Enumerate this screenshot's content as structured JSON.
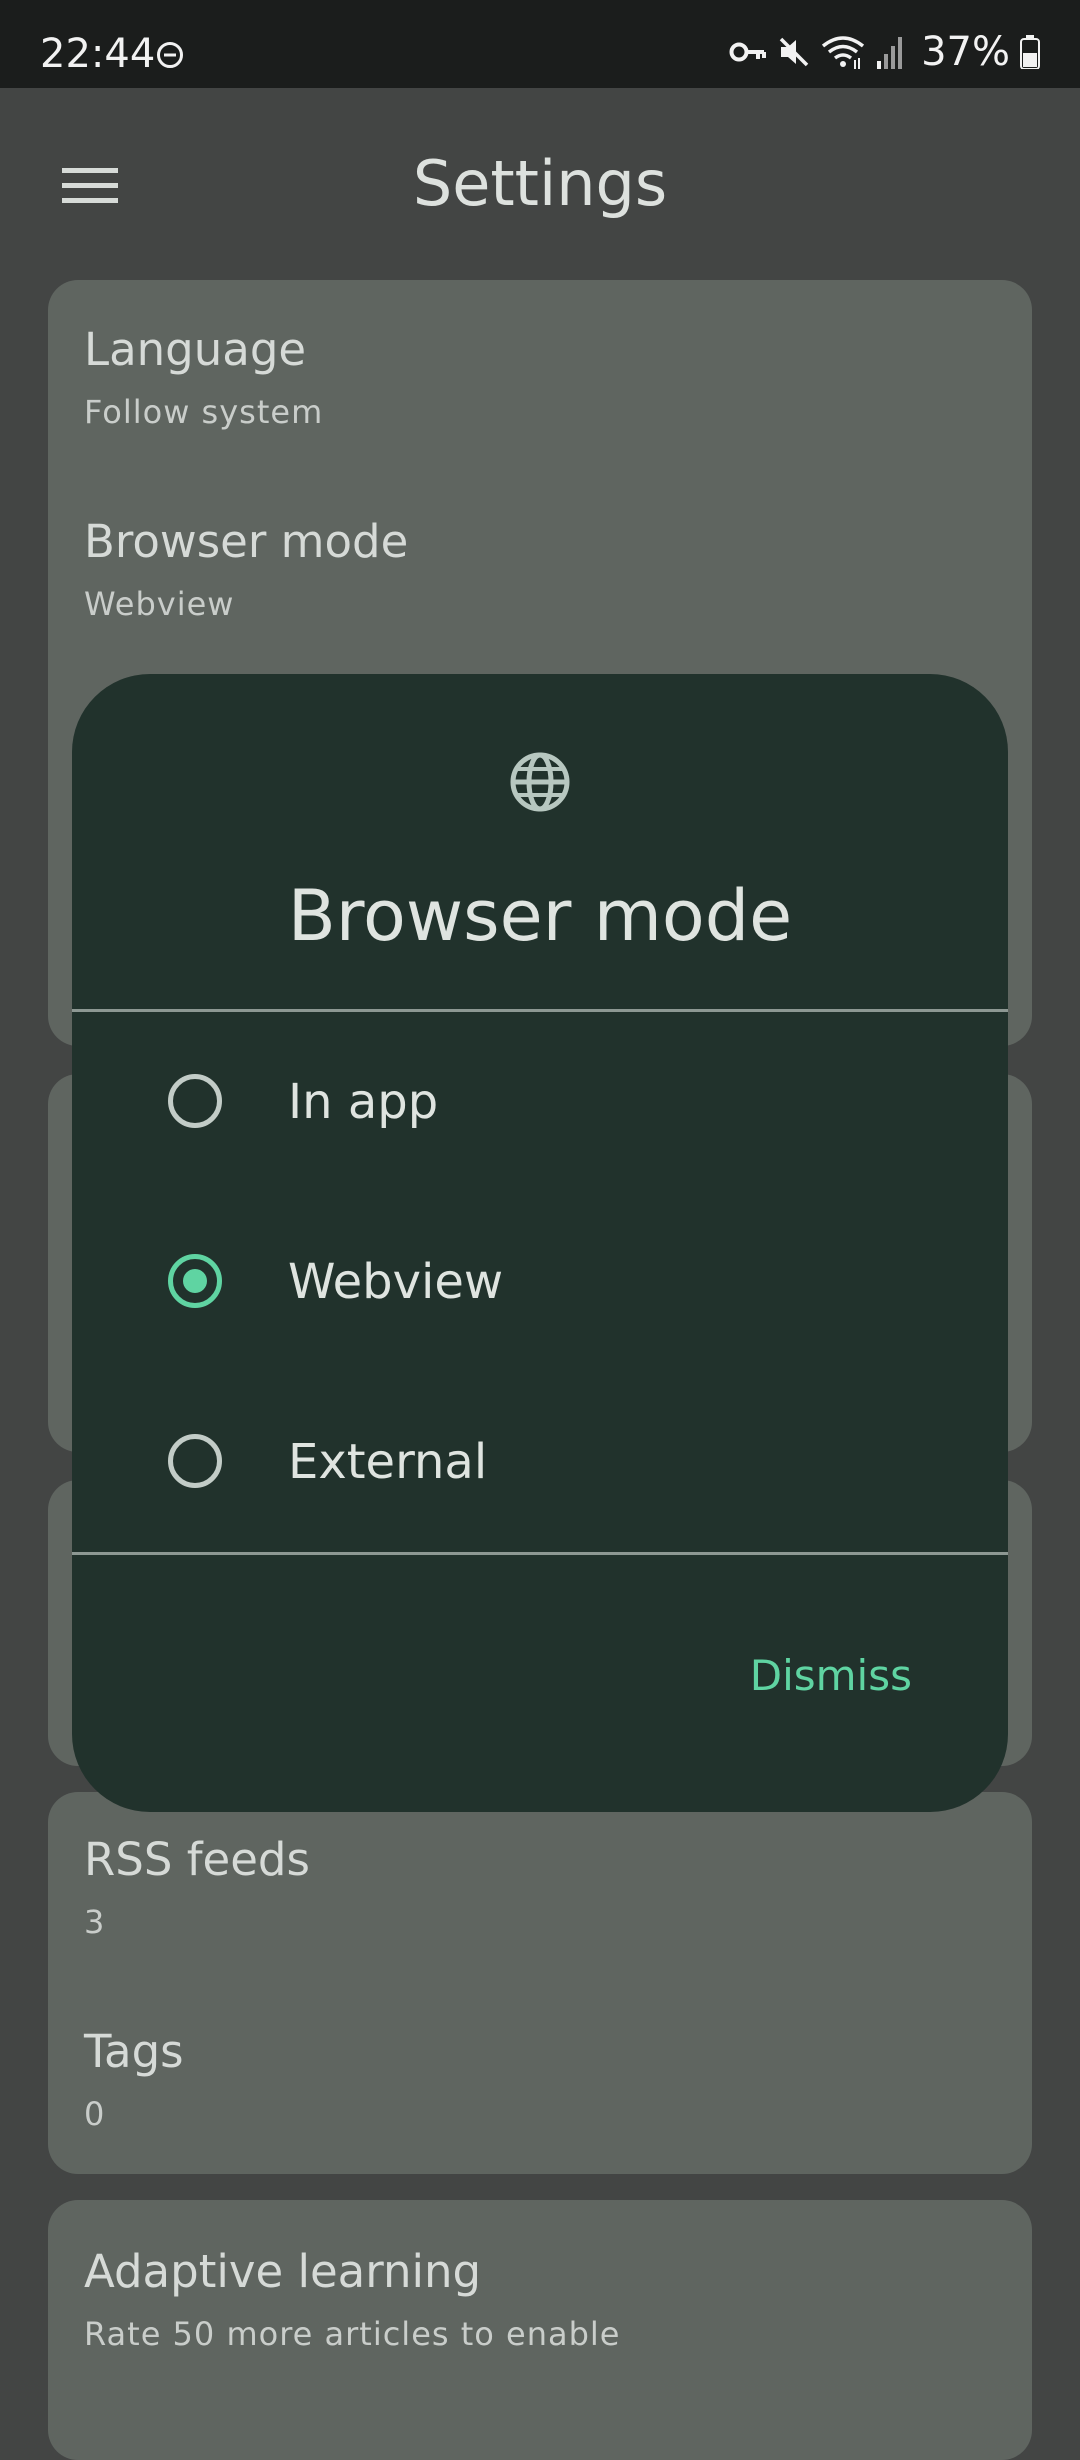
{
  "status_bar": {
    "time": "22:44",
    "battery": "37%",
    "icons": [
      "do-not-disturb-icon",
      "vpn-key-icon",
      "mute-icon",
      "wifi-icon",
      "signal-icon",
      "battery-icon"
    ]
  },
  "header": {
    "title": "Settings",
    "menu_icon": "hamburger-menu-icon"
  },
  "settings": {
    "card1": [
      {
        "title": "Language",
        "subtitle": "Follow system"
      },
      {
        "title": "Browser mode",
        "subtitle": "Webview"
      }
    ],
    "card4": [
      {
        "title": "RSS feeds",
        "subtitle": "3"
      },
      {
        "title": "Tags",
        "subtitle": "0"
      }
    ],
    "card5": [
      {
        "title": "Adaptive learning",
        "subtitle": "Rate 50 more articles to enable"
      }
    ]
  },
  "dialog": {
    "icon": "globe-icon",
    "title": "Browser mode",
    "options": [
      {
        "label": "In app",
        "selected": false
      },
      {
        "label": "Webview",
        "selected": true
      },
      {
        "label": "External",
        "selected": false
      }
    ],
    "dismiss_label": "Dismiss"
  },
  "colors": {
    "accent": "#5fd4a2",
    "dialog_bg": "#21322c",
    "card_bg": "#5f6560",
    "page_bg": "#434544",
    "status_bar_bg": "#1b1d1c"
  }
}
